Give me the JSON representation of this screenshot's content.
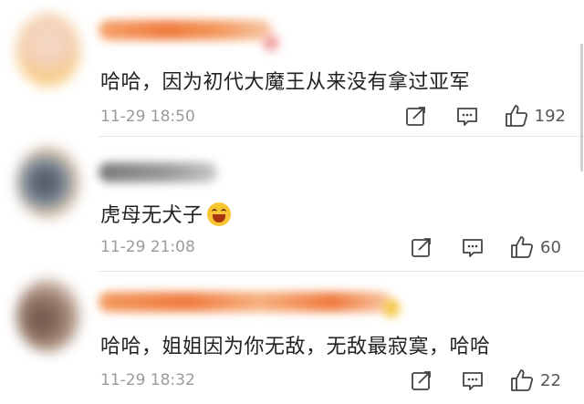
{
  "comments": [
    {
      "text": "哈哈，因为初代大魔王从来没有拿过亚军",
      "time": "11-29 18:50",
      "likes": "192",
      "avatar_icon": "blurred-avatar",
      "username_color": "#f07a3c"
    },
    {
      "text": "虎母无犬子",
      "time": "11-29 21:08",
      "likes": "60",
      "emoji_icon": "laughing-face-emoji",
      "avatar_icon": "blurred-avatar",
      "username_color": "#8a8a8a"
    },
    {
      "text": "哈哈，姐姐因为你无敌，无敌最寂寞，哈哈",
      "time": "11-29 18:32",
      "likes": "22",
      "avatar_icon": "blurred-avatar",
      "username_color": "#f07a3c"
    }
  ],
  "icons": {
    "share": "share-icon",
    "reply": "comment-icon",
    "like": "thumbs-up-icon"
  },
  "colors": {
    "text": "#222222",
    "meta": "#9a9a9a",
    "redacted_name_orange": "#f07a3c",
    "redacted_name_gray": "#8a8a8a"
  }
}
